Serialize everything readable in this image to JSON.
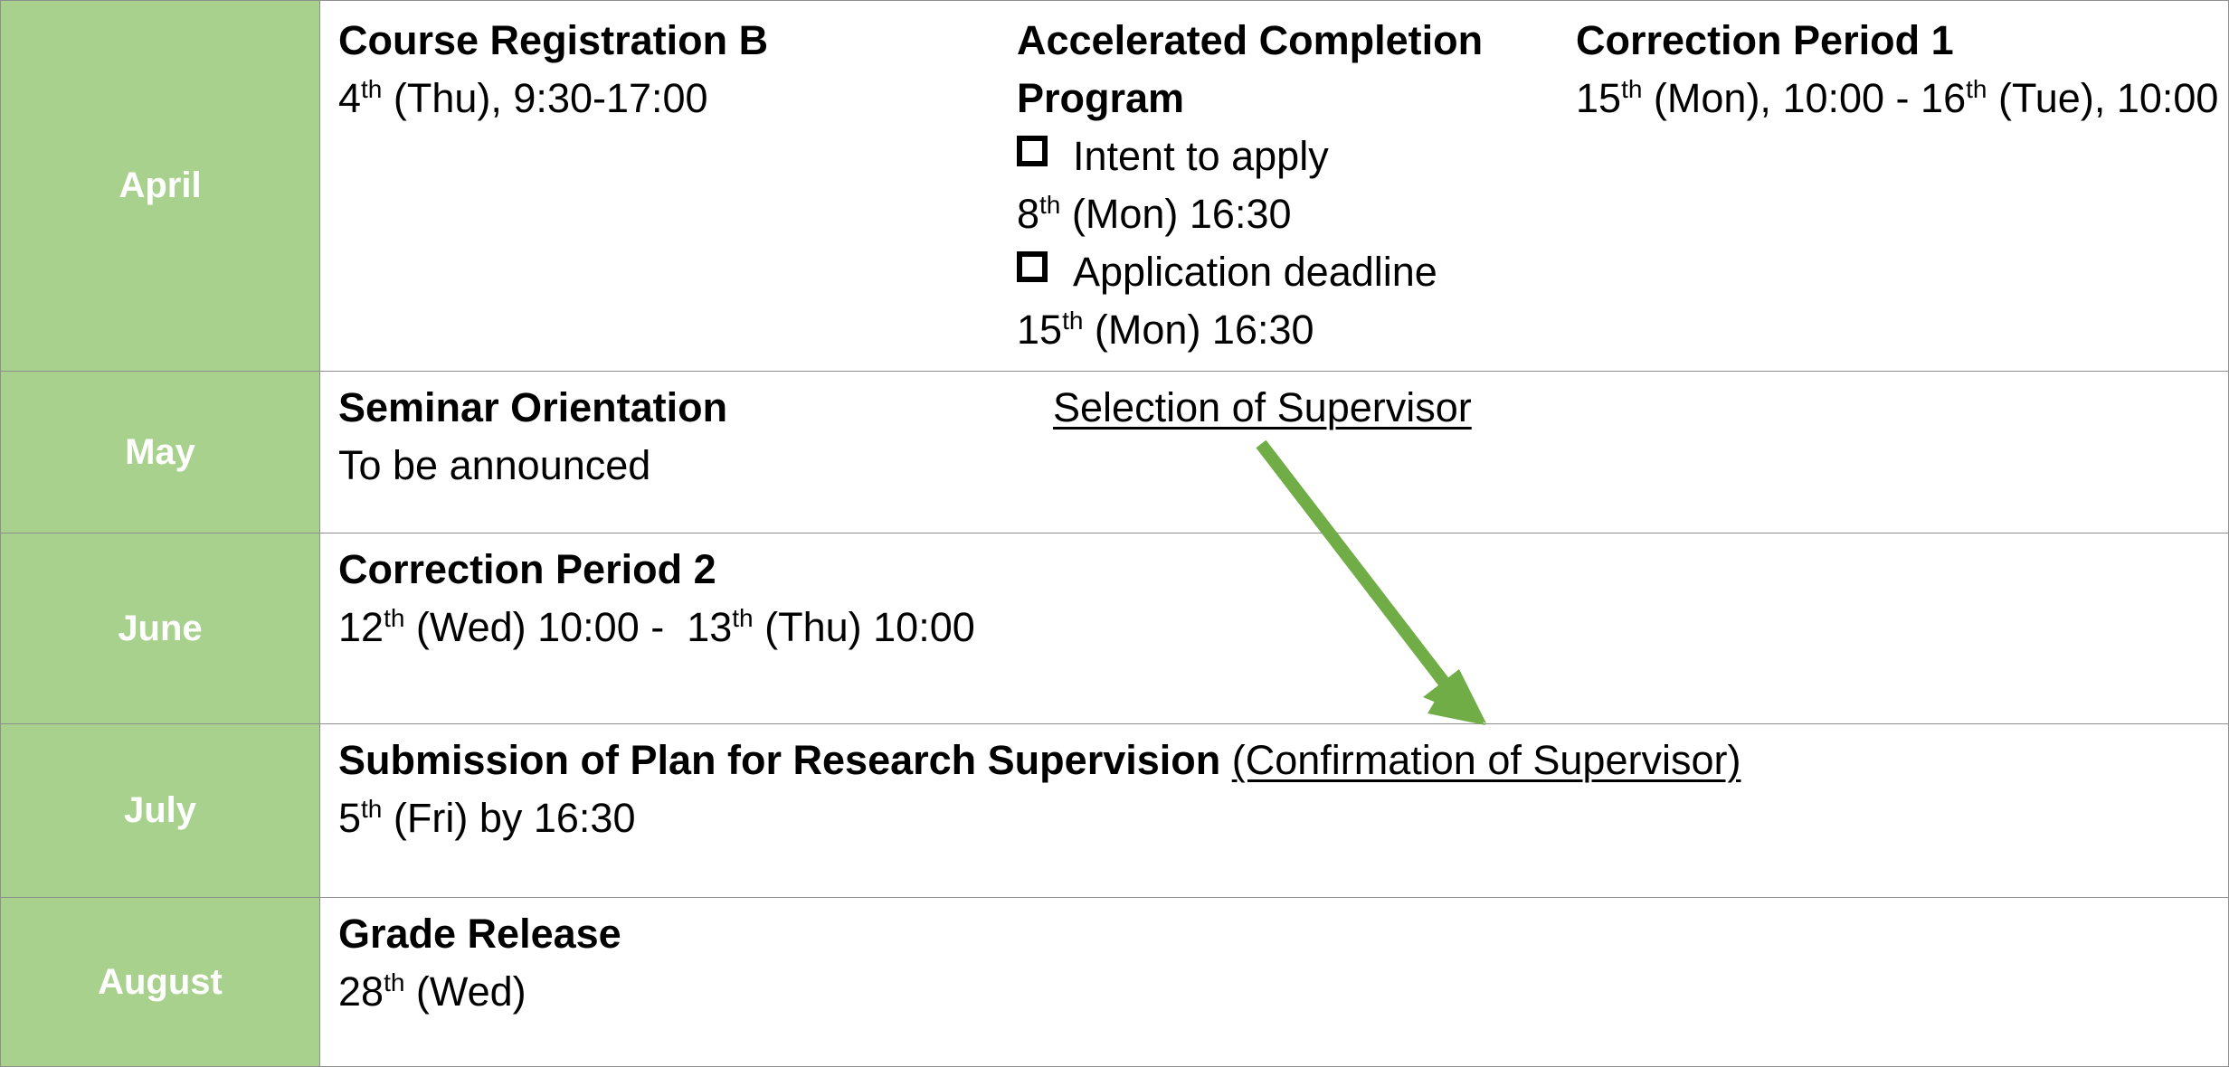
{
  "months": [
    "April",
    "May",
    "June",
    "July",
    "August"
  ],
  "april": {
    "course_registration": {
      "title": "Course Registration B",
      "date": {
        "day": "4",
        "suffix": "th",
        "rest": " (Thu), 9:30-17:00"
      }
    },
    "accelerated": {
      "title": "Accelerated Completion Program",
      "intent_label": "Intent to apply",
      "intent_date": {
        "day": "8",
        "suffix": "th",
        "rest": " (Mon) 16:30"
      },
      "application_label": "Application deadline",
      "application_date": {
        "day": "15",
        "suffix": "th",
        "rest": " (Mon) 16:30"
      }
    },
    "correction1": {
      "title": "Correction Period 1",
      "start_day": "15",
      "start_suffix": "th",
      "start_rest": " (Mon), 10:00 - ",
      "end_day": "16",
      "end_suffix": "th",
      "end_rest": " (Tue), 10:00"
    }
  },
  "may": {
    "seminar_title": "Seminar Orientation",
    "seminar_date": "To be announced",
    "selection_link": "Selection of Supervisor"
  },
  "june": {
    "title": "Correction Period 2",
    "start_day": "12",
    "start_suffix": "th",
    "start_rest": " (Wed) 10:00 -  ",
    "end_day": "13",
    "end_suffix": "th",
    "end_rest": " (Thu) 10:00"
  },
  "july": {
    "title": "Submission of Plan for Research Supervision",
    "confirmation_link": "(Confirmation of Supervisor)",
    "date": {
      "day": "5",
      "suffix": "th",
      "rest": " (Fri) by 16:30"
    }
  },
  "august": {
    "title": "Grade Release",
    "date": {
      "day": "28",
      "suffix": "th",
      "rest": " (Wed)"
    }
  },
  "colors": {
    "month_bg": "#a9d18e",
    "month_text": "#ffffff",
    "arrow": "#70ad47"
  }
}
